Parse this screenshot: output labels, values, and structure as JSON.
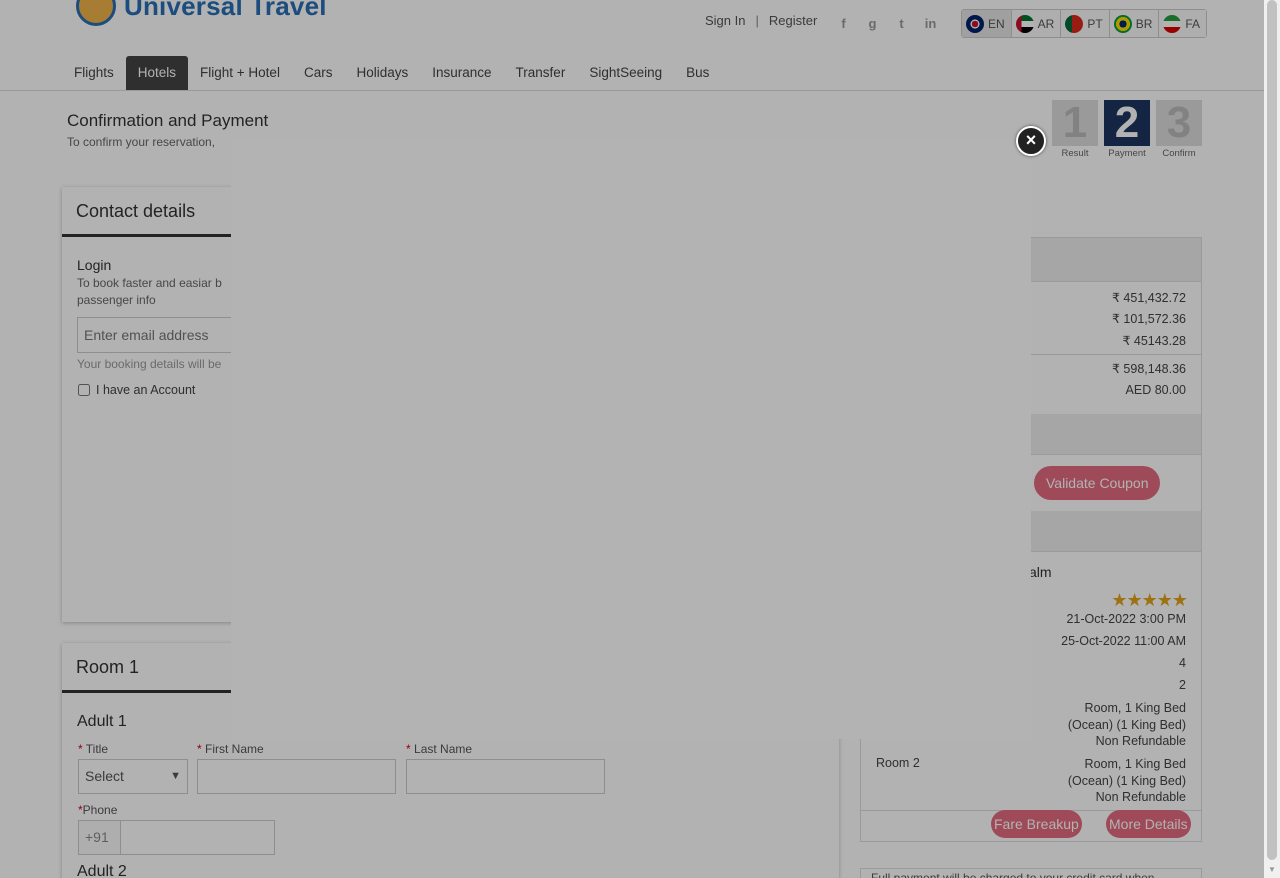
{
  "brand": {
    "name": "Universal Travel"
  },
  "auth": {
    "sign_in": "Sign In",
    "separator": "|",
    "register": "Register"
  },
  "socials": [
    "f",
    "g",
    "t",
    "in"
  ],
  "languages": [
    {
      "code": "EN",
      "flag": "uk-flag-icon",
      "active": true
    },
    {
      "code": "AR",
      "flag": "uae-flag-icon"
    },
    {
      "code": "PT",
      "flag": "portugal-flag-icon"
    },
    {
      "code": "BR",
      "flag": "brazil-flag-icon"
    },
    {
      "code": "FA",
      "flag": "iran-flag-icon"
    }
  ],
  "nav": [
    "Flights",
    "Hotels",
    "Flight + Hotel",
    "Cars",
    "Holidays",
    "Insurance",
    "Transfer",
    "SightSeeing",
    "Bus"
  ],
  "nav_active": "Hotels",
  "page": {
    "title": "Confirmation and Payment",
    "subtitle": "To confirm your reservation,"
  },
  "steps": [
    {
      "num": "1",
      "label": "Result"
    },
    {
      "num": "2",
      "label": "Payment",
      "active": true
    },
    {
      "num": "3",
      "label": "Confirm"
    }
  ],
  "contact": {
    "heading": "Contact details",
    "login_title": "Login",
    "login_desc_1": "To book faster and easiar b",
    "login_desc_2": "passenger info",
    "email_placeholder": "Enter email address",
    "note": "Your booking details will be",
    "account_label": "I have an Account"
  },
  "room": {
    "heading": "Room 1",
    "adult1": "Adult 1",
    "title_label": "Title",
    "title_value": "Select",
    "first_name_label": "First Name",
    "last_name_label": "Last Name",
    "phone_label": "Phone",
    "phone_prefix": "+91",
    "adult2": "Adult 2"
  },
  "summary": {
    "prices": [
      "₹ 451,432.72",
      "₹ 101,572.36",
      "₹ 45143.28"
    ],
    "total": "₹ 598,148.36",
    "extra": "AED 80.00",
    "coupon_button": "Validate Coupon",
    "hotel_name_tail": "alm",
    "stars": "★★★★★",
    "check_in": "21-Oct-2022 3:00 PM",
    "check_out": "25-Oct-2022 11:00 AM",
    "nights": "4",
    "rooms": "2",
    "room1_desc_1": "Room, 1 King Bed",
    "room1_desc_2": "(Ocean) (1 King Bed)",
    "room1_desc_3": "Non Refundable",
    "room2_label": "Room 2",
    "room2_desc_1": "Room, 1 King Bed",
    "room2_desc_2": "(Ocean) (1 King Bed)",
    "room2_desc_3": "Non Refundable",
    "fare_breakup": "Fare Breakup",
    "more_details": "More Details",
    "full_payment": "Full payment will be charged to your credit card when"
  },
  "modal": {
    "close_symbol": "×"
  },
  "colors": {
    "accent": "#1d3561",
    "pink": "#e36b7e",
    "star": "#e3a21a"
  }
}
